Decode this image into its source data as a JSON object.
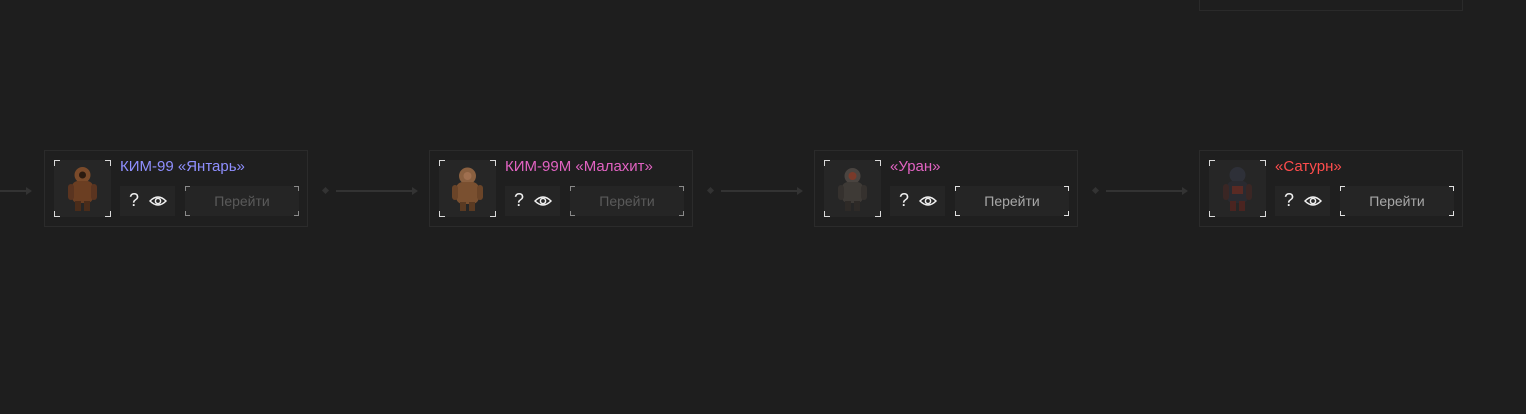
{
  "colors": {
    "background": "#1e1e1e",
    "amber": "#8f8fff",
    "malachite": "#e263c2",
    "uranus": "#e263c2",
    "saturn": "#ff4d4d"
  },
  "cards": [
    {
      "title": "КИМ-99 «Янтарь»",
      "title_color": "#8f8fff",
      "help_icon": "?",
      "view_icon": "eye-icon",
      "go_label": "Перейти",
      "go_enabled": false
    },
    {
      "title": "КИМ-99М «Малахит»",
      "title_color": "#e263c2",
      "help_icon": "?",
      "view_icon": "eye-icon",
      "go_label": "Перейти",
      "go_enabled": false
    },
    {
      "title": "«Уран»",
      "title_color": "#e263c2",
      "help_icon": "?",
      "view_icon": "eye-icon",
      "go_label": "Перейти",
      "go_enabled": true
    },
    {
      "title": "«Сатурн»",
      "title_color": "#ff4d4d",
      "help_icon": "?",
      "view_icon": "eye-icon",
      "go_label": "Перейти",
      "go_enabled": true
    }
  ]
}
